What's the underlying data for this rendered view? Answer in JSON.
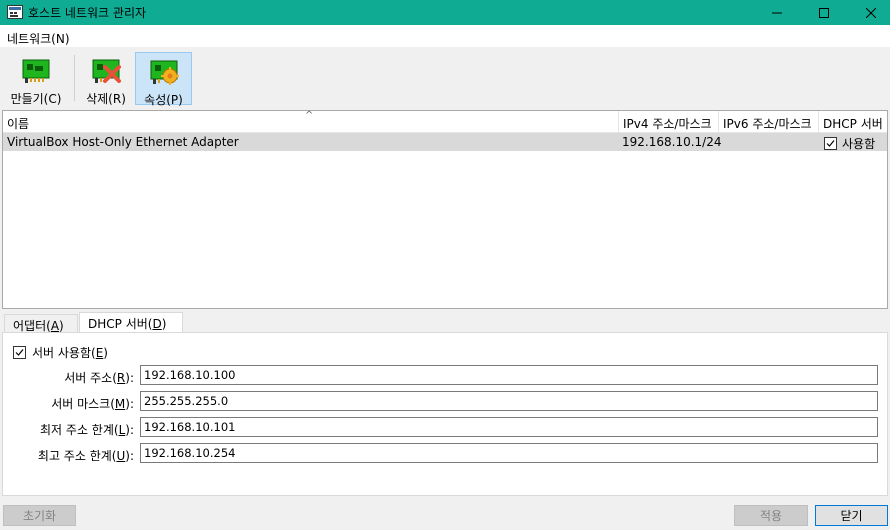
{
  "window": {
    "title": "호스트 네트워크 관리자",
    "accent_color": "#0fac93",
    "controls": [
      "minimize-icon",
      "maximize-icon",
      "close-icon"
    ]
  },
  "menu": {
    "network": "네트워크(N)"
  },
  "toolbar": {
    "create_label": "만들기(C)",
    "delete_label": "삭제(R)",
    "properties_label": "속성(P)",
    "active": "properties"
  },
  "table": {
    "columns": [
      "이름",
      "IPv4 주소/마스크",
      "IPv6 주소/마스크",
      "DHCP 서버"
    ],
    "rows": [
      {
        "name": "VirtualBox Host-Only Ethernet Adapter",
        "ipv4": "192.168.10.1/24",
        "ipv6": "",
        "dhcp": "사용함",
        "dhcp_checked": true,
        "selected": true
      }
    ]
  },
  "tabs": {
    "adapter_prefix": "어댑터(",
    "adapter_key": "A",
    "adapter_suffix": ")",
    "dhcp_prefix": "DHCP 서버(",
    "dhcp_key": "D",
    "dhcp_suffix": ")",
    "active": "dhcp"
  },
  "dhcp": {
    "enable_prefix": "서버 사용함(",
    "enable_key": "E",
    "enable_suffix": ")",
    "enabled": true,
    "fields": [
      {
        "prefix": "서버 주소(",
        "key": "R",
        "suffix": "):",
        "value": "192.168.10.100"
      },
      {
        "prefix": "서버 마스크(",
        "key": "M",
        "suffix": "):",
        "value": "255.255.255.0"
      },
      {
        "prefix": "최저 주소 한계(",
        "key": "L",
        "suffix": "):",
        "value": "192.168.10.101"
      },
      {
        "prefix": "최고 주소 한계(",
        "key": "U",
        "suffix": "):",
        "value": "192.168.10.254"
      }
    ]
  },
  "buttons": {
    "reset": "초기화",
    "apply": "적용",
    "close": "닫기"
  }
}
